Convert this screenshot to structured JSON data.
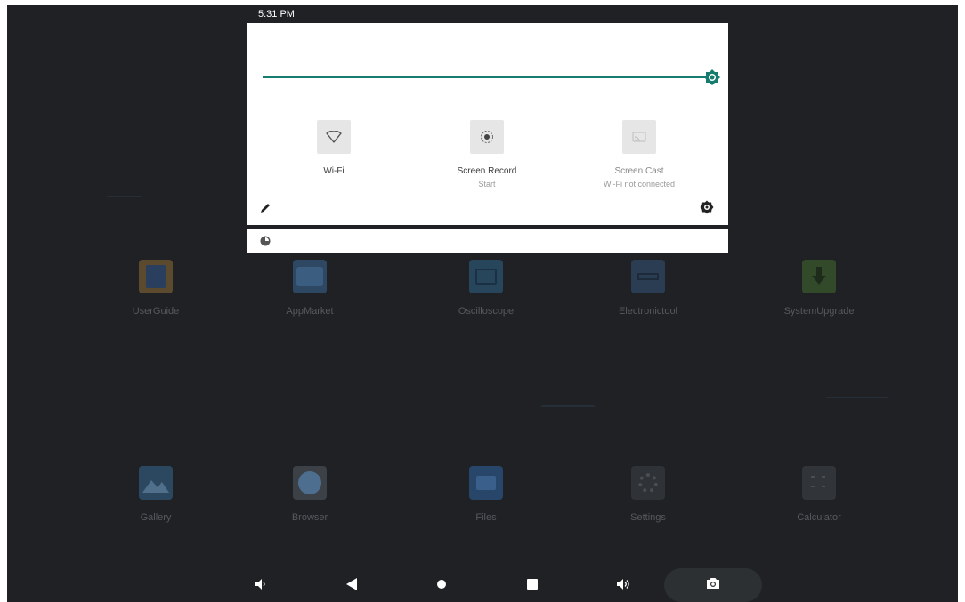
{
  "status_bar": {
    "time": "5:31 PM"
  },
  "quick_settings": {
    "brightness": {
      "level": 1.0,
      "accent": "#167c6e"
    },
    "tiles": [
      {
        "label": "Wi-Fi",
        "sublabel": "",
        "icon": "wifi-icon",
        "state": "off"
      },
      {
        "label": "Screen Record",
        "sublabel": "Start",
        "icon": "screen-record-icon",
        "state": "off"
      },
      {
        "label": "Screen Cast",
        "sublabel": "Wi-Fi not connected",
        "icon": "screen-cast-icon",
        "state": "unavailable"
      }
    ],
    "edit_icon": "pencil-icon",
    "settings_icon": "gear-icon"
  },
  "notification": {
    "icon": "app-notification-icon"
  },
  "launcher": {
    "row1": [
      {
        "label": "UserGuide",
        "color": "#5b4a2e"
      },
      {
        "label": "AppMarket",
        "color": "#2e4863"
      },
      {
        "label": "Oscilloscope",
        "color": "#27465c"
      },
      {
        "label": "Electronictool",
        "color": "#2a3d52"
      },
      {
        "label": "SystemUpgrade",
        "color": "#334a2a"
      }
    ],
    "row2": [
      {
        "label": "Gallery",
        "color": "#2c4860"
      },
      {
        "label": "Browser",
        "color": "#3c4147"
      },
      {
        "label": "Files",
        "color": "#28466a"
      },
      {
        "label": "Settings",
        "color": "#2f3236"
      },
      {
        "label": "Calculator",
        "color": "#313438"
      }
    ]
  },
  "nav_bar": {
    "buttons": [
      "volume-down-icon",
      "back-icon",
      "home-icon",
      "recents-icon",
      "volume-up-icon",
      "camera-icon"
    ]
  }
}
